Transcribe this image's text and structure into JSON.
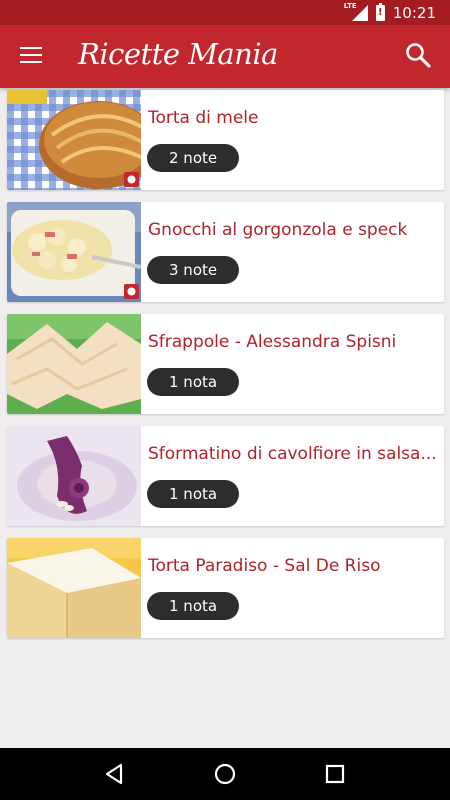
{
  "status_bar": {
    "network": "LTE",
    "time": "10:21"
  },
  "app_bar": {
    "title": "Ricette Mania"
  },
  "recipes": [
    {
      "title": "Torta di mele",
      "notes": "2 note"
    },
    {
      "title": "Gnocchi al gorgonzola e speck",
      "notes": "3 note"
    },
    {
      "title": "Sfrappole - Alessandra Spisni",
      "notes": "1 nota"
    },
    {
      "title": "Sformatino di cavolfiore in salsa...",
      "notes": "1 nota"
    },
    {
      "title": "Torta Paradiso - Sal De Riso",
      "notes": "1 nota"
    }
  ],
  "colors": {
    "status_bar": "#a41c1f",
    "app_bar": "#c2272d",
    "title_text": "#b2222a",
    "badge": "#2d2d2d",
    "background": "#efeded"
  },
  "icons": {
    "menu": "hamburger-menu-icon",
    "search": "search-icon",
    "back": "back-triangle-icon",
    "home": "home-circle-icon",
    "recents": "recents-square-icon"
  }
}
